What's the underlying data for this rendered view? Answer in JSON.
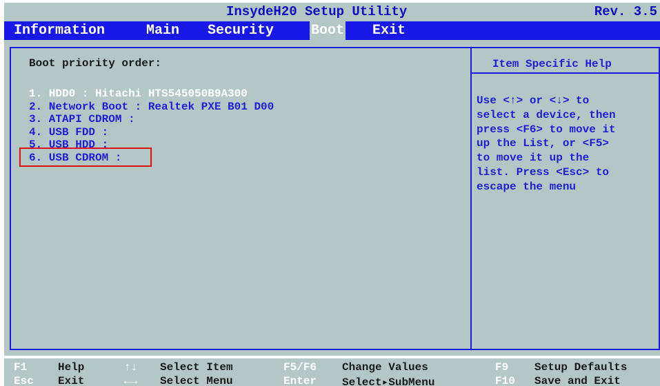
{
  "titlebar": {
    "title": "InsydeH20 Setup Utility",
    "rev": "Rev. 3.5"
  },
  "menu": {
    "items": [
      {
        "label": "Information",
        "active": false
      },
      {
        "label": "Main",
        "active": false
      },
      {
        "label": "Security",
        "active": false
      },
      {
        "label": "Boot",
        "active": true
      },
      {
        "label": "Exit",
        "active": false
      }
    ]
  },
  "main": {
    "heading": "Boot priority order:",
    "boot_items": [
      "1. HDD0 : Hitachi HTS545050B9A300",
      "2. Network Boot : Realtek PXE B01 D00",
      "3. ATAPI CDROM :",
      "4. USB FDD :",
      "5. USB HDD :",
      "6. USB CDROM :"
    ],
    "selected_index": 0,
    "highlighted_index": 4
  },
  "help": {
    "title": "Item Specific Help",
    "text": "Use <↑> or <↓> to\nselect a device, then\npress <F6> to move it\nup the List, or <F5>\nto move it up the\nlist. Press <Esc> to\nescape the menu"
  },
  "footer": {
    "row1": [
      {
        "key": "F1",
        "desc": "Help"
      },
      {
        "key": "↑↓",
        "desc": "Select Item"
      },
      {
        "key": "F5/F6",
        "desc": "Change Values"
      },
      {
        "key": "F9",
        "desc": "Setup Defaults"
      }
    ],
    "row2": [
      {
        "key": "Esc",
        "desc": "Exit"
      },
      {
        "key": "←→",
        "desc": "Select Menu"
      },
      {
        "key": "Enter",
        "desc": "Select▸SubMenu"
      },
      {
        "key": "F10",
        "desc": "Save and Exit"
      }
    ]
  },
  "colors": {
    "background": "#b3c7c7",
    "menubar": "#1818e8",
    "text_blue": "#1e1ed6",
    "highlight_red": "#e01010"
  }
}
